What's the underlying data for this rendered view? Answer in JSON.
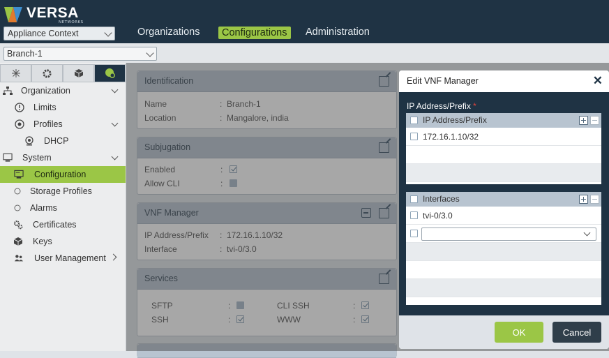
{
  "app": {
    "brand": "VERSA",
    "brand_sub": "NETWORKS"
  },
  "context_select": {
    "value": "Appliance Context"
  },
  "nav": [
    {
      "label": "Organizations"
    },
    {
      "label": "Configurations",
      "active": true
    },
    {
      "label": "Administration"
    }
  ],
  "branch_select": {
    "value": "Branch-1"
  },
  "sidebar": {
    "tabs": [
      "network-icon",
      "gear-icon",
      "cube-icon",
      "globe-gear-icon"
    ],
    "items": [
      {
        "label": "Organization",
        "icon": "org-icon",
        "expandable": true
      },
      {
        "label": "Limits",
        "icon": "limits-icon"
      },
      {
        "label": "Profiles",
        "icon": "profiles-icon",
        "expandable": true
      },
      {
        "label": "DHCP",
        "icon": "dhcp-icon"
      },
      {
        "label": "System",
        "icon": "system-icon",
        "expandable": true
      },
      {
        "label": "Configuration",
        "icon": "config-icon",
        "active": true
      },
      {
        "label": "Storage Profiles",
        "icon": "circle-icon"
      },
      {
        "label": "Alarms",
        "icon": "circle-icon"
      },
      {
        "label": "Certificates",
        "icon": "certificates-icon"
      },
      {
        "label": "Keys",
        "icon": "keys-icon"
      },
      {
        "label": "User Management",
        "icon": "users-icon",
        "submenu": true
      }
    ]
  },
  "identification": {
    "title": "Identification",
    "name_label": "Name",
    "name_value": "Branch-1",
    "location_label": "Location",
    "location_value": "Mangalore, india"
  },
  "subjugation": {
    "title": "Subjugation",
    "enabled_label": "Enabled",
    "allow_cli_label": "Allow CLI"
  },
  "vnf_manager": {
    "title": "VNF Manager",
    "ip_label": "IP Address/Prefix",
    "ip_value": "172.16.1.10/32",
    "interface_label": "Interface",
    "interface_value": "tvi-0/3.0"
  },
  "services": {
    "title": "Services",
    "sftp": "SFTP",
    "ssh": "SSH",
    "cli_ssh": "CLI SSH",
    "www": "WWW"
  },
  "modal": {
    "title": "Edit VNF Manager",
    "field_label": "IP Address/Prefix",
    "ip_table_header": "IP Address/Prefix",
    "ip_rows": [
      "172.16.1.10/32"
    ],
    "if_table_header": "Interfaces",
    "if_rows": [
      "tvi-0/3.0"
    ],
    "ok_label": "OK",
    "cancel_label": "Cancel"
  },
  "colors": {
    "accent": "#9bc646",
    "header_bg": "#1f3344",
    "card_header": "#b8c4d0"
  }
}
